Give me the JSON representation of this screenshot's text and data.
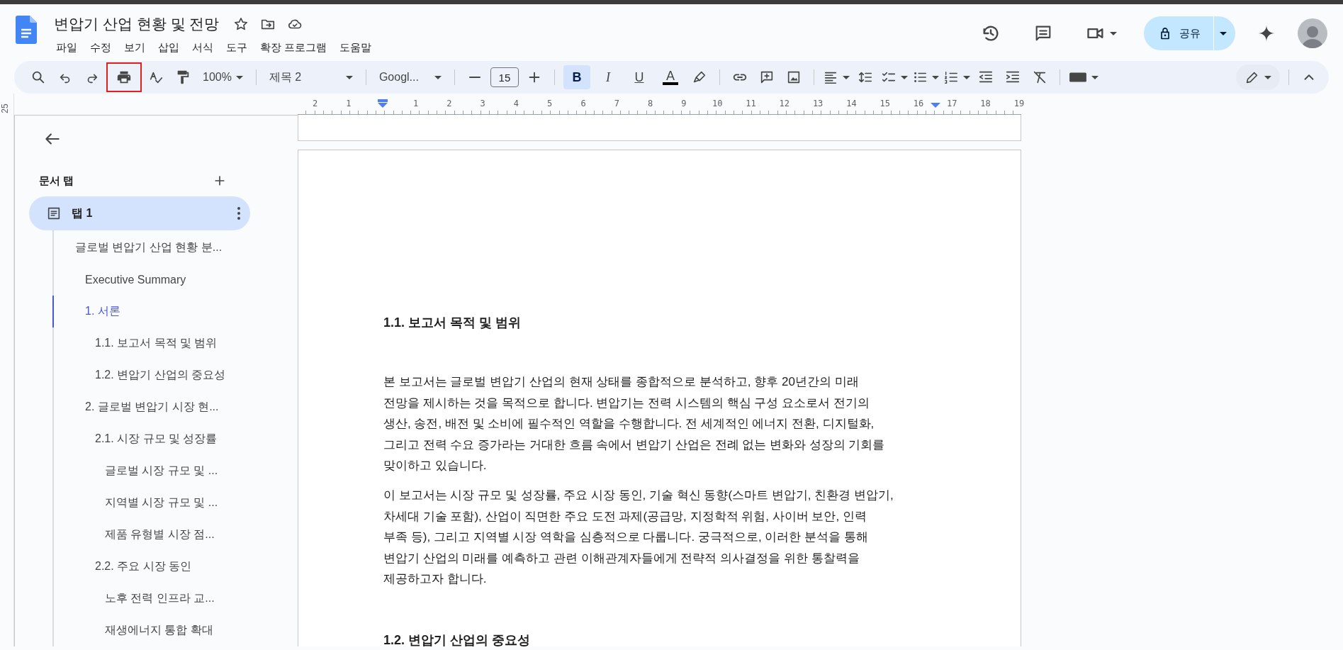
{
  "document_title": "변압기 산업 현황 및 전망",
  "menu": [
    "파일",
    "수정",
    "보기",
    "삽입",
    "서식",
    "도구",
    "확장 프로그램",
    "도움말"
  ],
  "share_button": {
    "label": "공유"
  },
  "toolbar": {
    "print": {
      "highlighted": true
    },
    "zoom": "100%",
    "style": "제목 2",
    "font": "Googl...",
    "font_size": "15",
    "bold": {
      "label": "B",
      "selected": true
    },
    "italic": {
      "label": "I",
      "selected": false
    },
    "underline": {
      "label": "U",
      "selected": false
    },
    "text_color": {
      "label": "A"
    }
  },
  "ruler": {
    "left_labels": [
      "2",
      "1"
    ],
    "right_labels": [
      "1",
      "2",
      "3",
      "4",
      "5",
      "6",
      "7",
      "8",
      "9",
      "10",
      "11",
      "12",
      "13",
      "14",
      "15",
      "16",
      "17",
      "18",
      "19"
    ]
  },
  "vertical_ruler": {
    "label": "25"
  },
  "sidebar": {
    "heading": "문서 탭",
    "tab": {
      "label": "탭 1",
      "selected": true
    },
    "outline": [
      {
        "label": "글로벌 변압기 산업 현황 분...",
        "selected": false,
        "children": [
          {
            "label": "Executive Summary",
            "selected": false
          },
          {
            "label": "1. 서론",
            "selected": true,
            "children": [
              {
                "label": "1.1. 보고서 목적 및 범위",
                "selected": false
              },
              {
                "label": "1.2. 변압기 산업의 중요성",
                "selected": false
              }
            ]
          },
          {
            "label": "2. 글로벌 변압기 시장 현...",
            "selected": false,
            "children": [
              {
                "label": "2.1. 시장 규모 및 성장률",
                "selected": false,
                "children": [
                  {
                    "label": "글로벌 시장 규모 및 ...",
                    "selected": false
                  },
                  {
                    "label": "지역별 시장 규모 및 ...",
                    "selected": false
                  },
                  {
                    "label": "제품 유형별 시장 점...",
                    "selected": false
                  }
                ]
              },
              {
                "label": "2.2. 주요 시장 동인",
                "selected": false,
                "children": [
                  {
                    "label": "노후 전력 인프라 교...",
                    "selected": false
                  },
                  {
                    "label": "재생에너지 통합 확대",
                    "selected": false
                  }
                ]
              }
            ]
          }
        ]
      }
    ]
  },
  "document": {
    "blocks": [
      {
        "kind": "heading",
        "text": "1.1. 보고서 목적 및 범위"
      },
      {
        "kind": "paragraph",
        "lines": [
          "본 보고서는 글로벌 변압기 산업의 현재 상태를 종합적으로 분석하고, 향후 20년간의 미래",
          "전망을 제시하는 것을 목적으로 합니다. 변압기는 전력 시스템의 핵심 구성 요소로서 전기의",
          "생산, 송전, 배전 및 소비에 필수적인 역할을 수행합니다. 전 세계적인 에너지 전환, 디지털화,",
          "그리고 전력 수요 증가라는 거대한 흐름 속에서 변압기 산업은 전례 없는 변화와 성장의 기회를",
          "맞이하고 있습니다."
        ]
      },
      {
        "kind": "paragraph",
        "lines": [
          "이 보고서는 시장 규모 및 성장률, 주요 시장 동인, 기술 혁신 동향(스마트 변압기, 친환경 변압기,",
          "차세대 기술 포함), 산업이 직면한 주요 도전 과제(공급망, 지정학적 위험, 사이버 보안, 인력",
          "부족 등), 그리고 지역별 시장 역학을 심층적으로 다룹니다. 궁극적으로, 이러한 분석을 통해",
          "변압기 산업의 미래를 예측하고 관련 이해관계자들에게 전략적 의사결정을 위한 통찰력을",
          "제공하고자 합니다."
        ]
      },
      {
        "kind": "heading",
        "text": "1.2. 변압기 산업의 중요성"
      }
    ]
  }
}
